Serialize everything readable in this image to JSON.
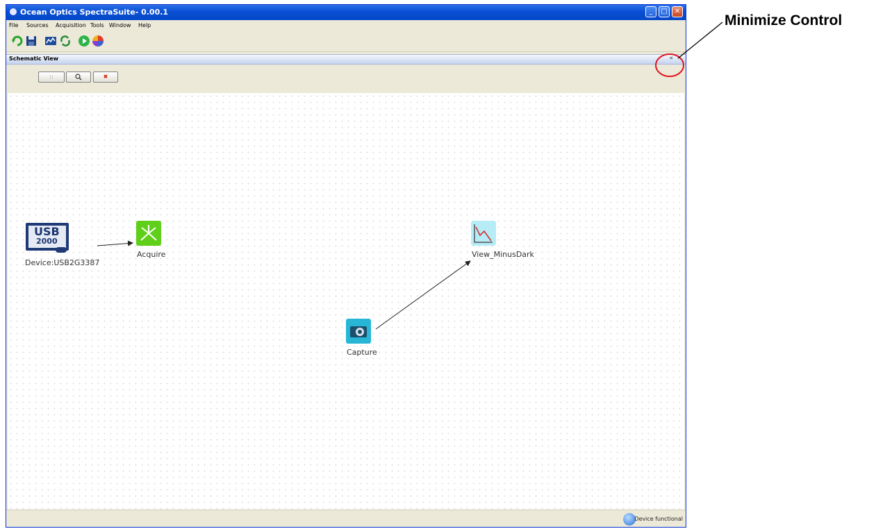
{
  "window": {
    "title": "Ocean Optics SpectraSuite- 0.00.1",
    "controls": [
      "minimize",
      "maximize",
      "close"
    ]
  },
  "menu": [
    "File",
    "Sources",
    "Acquisition",
    "Tools",
    "Window",
    "Help"
  ],
  "toolbar": {
    "icons": [
      "refresh-icon",
      "save-icon",
      "spectrum-icon",
      "reload-icon",
      "play-icon",
      "color-wheel-icon"
    ]
  },
  "panel": {
    "title": "Schematic View",
    "collapse_glyph": "«"
  },
  "schematic_toolbar": {
    "buttons": [
      "select",
      "zoom",
      "delete"
    ],
    "select_glyph": "::",
    "zoom_glyph": "🔍",
    "delete_glyph": "✖"
  },
  "nodes": {
    "device": {
      "icon_text_top": "USB",
      "icon_text_bottom": "2000",
      "label": "Device:USB2G3387"
    },
    "acquire": {
      "label": "Acquire"
    },
    "view": {
      "label": "View_MinusDark"
    },
    "capture": {
      "label": "Capture"
    }
  },
  "status": {
    "text": "Device functional"
  },
  "annotation": {
    "text": "Minimize Control"
  },
  "colors": {
    "title_bar": "#0a4fd4",
    "highlight_circle": "#e0141e",
    "acquire_node": "#5fcf1a",
    "capture_node": "#27b6d6"
  }
}
